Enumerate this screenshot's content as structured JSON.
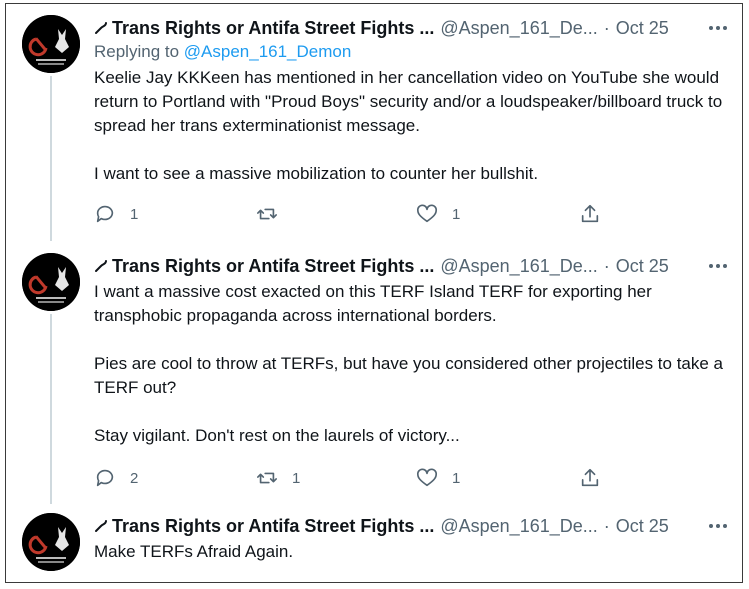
{
  "tweets": [
    {
      "display_name": "Trans Rights or Antifa Street Fights ...",
      "handle": "@Aspen_161_De...",
      "separator": "·",
      "date": "Oct 25",
      "replying_prefix": "Replying to ",
      "replying_to": "@Aspen_161_Demon",
      "paragraphs": [
        "Keelie Jay KKKeen has mentioned in her cancellation video on YouTube she would return to Portland with \"Proud Boys\" security and/or a loudspeaker/billboard truck to spread her trans exterminationist message.",
        "I want to see a massive mobilization to counter her bullshit."
      ],
      "reply_count": "1",
      "retweet_count": "",
      "like_count": "1"
    },
    {
      "display_name": "Trans Rights or Antifa Street Fights ...",
      "handle": "@Aspen_161_De...",
      "separator": "·",
      "date": "Oct 25",
      "paragraphs": [
        "I want a massive cost exacted on this TERF Island TERF for exporting her transphobic propaganda across international borders.",
        "Pies are cool to throw at TERFs, but have you considered other projectiles to take a TERF out?",
        "Stay vigilant. Don't rest on the laurels of victory..."
      ],
      "reply_count": "2",
      "retweet_count": "1",
      "like_count": "1"
    },
    {
      "display_name": "Trans Rights or Antifa Street Fights ...",
      "handle": "@Aspen_161_De...",
      "separator": "·",
      "date": "Oct 25",
      "paragraphs": [
        "Make TERFs Afraid Again."
      ]
    }
  ],
  "icons": {
    "name_prefix": "sickle-icon",
    "more": "more-icon",
    "reply": "reply-icon",
    "retweet": "retweet-icon",
    "like": "like-icon",
    "share": "share-icon"
  },
  "colors": {
    "text": "#0f1419",
    "secondary": "#536471",
    "link": "#1d9bf0",
    "avatar_bg": "#000000",
    "avatar_accent": "#c0392b"
  }
}
